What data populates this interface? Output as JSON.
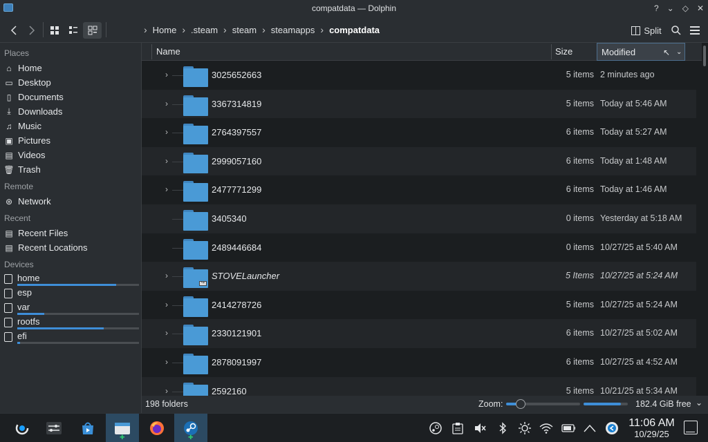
{
  "window": {
    "title": "compatdata — Dolphin"
  },
  "titlebar_controls": [
    "?",
    "⌄",
    "◇",
    "✕"
  ],
  "toolbar": {
    "split_label": "Split"
  },
  "breadcrumbs": [
    "Home",
    ".steam",
    "steam",
    "steamapps",
    "compatdata"
  ],
  "sidebar": {
    "places_label": "Places",
    "places": [
      {
        "label": "Home",
        "icon": "home-icon"
      },
      {
        "label": "Desktop",
        "icon": "desktop-icon"
      },
      {
        "label": "Documents",
        "icon": "documents-icon"
      },
      {
        "label": "Downloads",
        "icon": "downloads-icon"
      },
      {
        "label": "Music",
        "icon": "music-icon"
      },
      {
        "label": "Pictures",
        "icon": "pictures-icon"
      },
      {
        "label": "Videos",
        "icon": "videos-icon"
      },
      {
        "label": "Trash",
        "icon": "trash-icon"
      }
    ],
    "remote_label": "Remote",
    "remote": [
      {
        "label": "Network",
        "icon": "network-icon"
      }
    ],
    "recent_label": "Recent",
    "recent": [
      {
        "label": "Recent Files",
        "icon": "recent-files-icon"
      },
      {
        "label": "Recent Locations",
        "icon": "recent-locations-icon"
      }
    ],
    "devices_label": "Devices",
    "devices": [
      {
        "label": "home",
        "usage": 0.81
      },
      {
        "label": "esp",
        "usage": 0.0
      },
      {
        "label": "var",
        "usage": 0.22
      },
      {
        "label": "rootfs",
        "usage": 0.71
      },
      {
        "label": "efi",
        "usage": 0.02
      }
    ]
  },
  "columns": {
    "name": "Name",
    "size": "Size",
    "modified": "Modified"
  },
  "rows": [
    {
      "name": "3025652663",
      "size": "5 items",
      "modified": "2 minutes ago",
      "expandable": true
    },
    {
      "name": "3367314819",
      "size": "5 items",
      "modified": "Today at 5:46 AM",
      "expandable": true
    },
    {
      "name": "2764397557",
      "size": "6 items",
      "modified": "Today at 5:27 AM",
      "expandable": true
    },
    {
      "name": "2999057160",
      "size": "6 items",
      "modified": "Today at 1:48 AM",
      "expandable": true
    },
    {
      "name": "2477771299",
      "size": "6 items",
      "modified": "Today at 1:46 AM",
      "expandable": true
    },
    {
      "name": "3405340",
      "size": "0 items",
      "modified": "Yesterday at 5:18 AM",
      "expandable": false
    },
    {
      "name": "2489446684",
      "size": "0 items",
      "modified": "10/27/25 at 5:40 AM",
      "expandable": false
    },
    {
      "name": "STOVELauncher",
      "size": "5 Items",
      "modified": "10/27/25 at 5:24 AM",
      "expandable": true,
      "symlink": true
    },
    {
      "name": "2414278726",
      "size": "5 items",
      "modified": "10/27/25 at 5:24 AM",
      "expandable": true
    },
    {
      "name": "2330121901",
      "size": "6 items",
      "modified": "10/27/25 at 5:02 AM",
      "expandable": true
    },
    {
      "name": "2878091997",
      "size": "6 items",
      "modified": "10/27/25 at 4:52 AM",
      "expandable": true
    },
    {
      "name": "2592160",
      "size": "5 items",
      "modified": "10/21/25 at 5:34 AM",
      "expandable": true
    }
  ],
  "status": {
    "count": "198 folders",
    "zoom_label": "Zoom:",
    "zoom_level": 0.2,
    "disk_usage": 0.85,
    "free": "182.4 GiB free"
  },
  "taskbar": {
    "time": "11:06 AM",
    "date": "10/29/25"
  },
  "colors": {
    "accent": "#3e8ed8",
    "folder": "#4a9ad6",
    "active_task": "#2c4a62"
  }
}
